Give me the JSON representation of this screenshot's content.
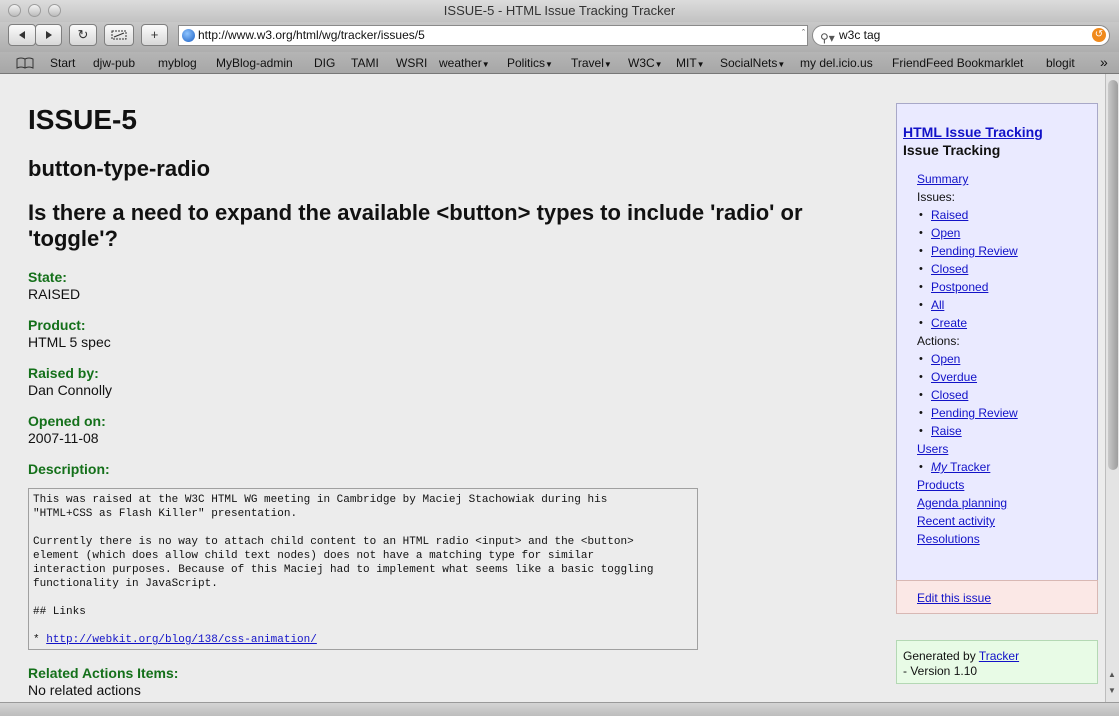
{
  "window": {
    "title": "ISSUE-5 - HTML Issue Tracking Tracker"
  },
  "toolbar": {
    "back_icon": "back-arrow-icon",
    "forward_icon": "forward-arrow-icon",
    "reload_icon": "reload-icon",
    "url": "http://www.w3.org/html/wg/tracker/issues/5",
    "search_value": "w3c tag"
  },
  "bookmarks": {
    "items": [
      "Start",
      "djw-pub",
      "myblog",
      "MyBlog-admin",
      "DIG",
      "TAMI",
      "WSRI",
      "weather",
      "Politics",
      "Travel",
      "W3C",
      "MIT",
      "SocialNets",
      "my del.icio.us",
      "FriendFeed Bookmarklet",
      "blogit"
    ]
  },
  "issue": {
    "id": "ISSUE-5",
    "short_name": "button-type-radio",
    "question": "Is there a need to expand the available <button> types to include 'radio' or 'toggle'?",
    "fields": [
      {
        "label": "State:",
        "value": "RAISED"
      },
      {
        "label": "Product:",
        "value": "HTML 5 spec"
      },
      {
        "label": "Raised by:",
        "value": "Dan Connolly"
      },
      {
        "label": "Opened on:",
        "value": "2007-11-08"
      }
    ],
    "description_label": "Description:",
    "description_text": "This was raised at the W3C HTML WG meeting in Cambridge by Maciej Stachowiak during his\n\"HTML+CSS as Flash Killer\" presentation.\n\nCurrently there is no way to attach child content to an HTML radio <input> and the <button>\nelement (which does allow child text nodes) does not have a matching type for similar\ninteraction purposes. Because of this Maciej had to implement what seems like a basic toggling\nfunctionality in JavaScript.\n\n## Links\n\n* ",
    "description_link": "http://webkit.org/blog/138/css-animation/",
    "related_label": "Related Actions Items:",
    "related_value": "No related actions"
  },
  "sidebar": {
    "title_link": "HTML Issue Tracking",
    "subtitle": "Issue Tracking",
    "summary": "Summary",
    "issues_label": "Issues:",
    "issues": [
      "Raised",
      "Open",
      "Pending Review",
      "Closed",
      "Postponed",
      "All",
      "Create"
    ],
    "actions_label": "Actions:",
    "actions": [
      "Open",
      "Overdue",
      "Closed",
      "Pending Review",
      "Raise"
    ],
    "users": "Users",
    "my_prefix": "My",
    "my_suffix": " Tracker",
    "products": "Products",
    "agenda": "Agenda planning",
    "recent": "Recent activity",
    "resolutions": "Resolutions",
    "edit": "Edit this issue",
    "generated_by": "Generated by ",
    "tracker_link": "Tracker",
    "version": "- Version 1.10"
  }
}
